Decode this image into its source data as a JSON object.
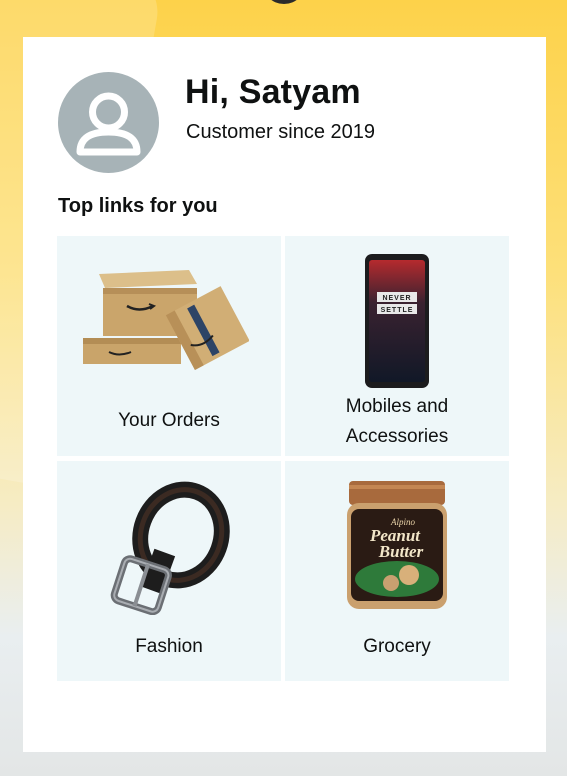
{
  "profile": {
    "greeting": "Hi, Satyam",
    "customer_since": "Customer since 2019",
    "avatar_icon": "user-silhouette-icon"
  },
  "top_links": {
    "title": "Top links for you",
    "items": [
      {
        "label": "Your Orders",
        "image": "amazon-boxes-image"
      },
      {
        "label_line1": "Mobiles and",
        "label_line2": "Accessories",
        "image": "smartphone-image"
      },
      {
        "label": "Fashion",
        "image": "leather-belt-image"
      },
      {
        "label": "Grocery",
        "image": "peanut-butter-jar-image"
      }
    ]
  },
  "product_text": {
    "phone_screen_line1": "NEVER",
    "phone_screen_line2": "SETTLE",
    "jar_line1": "Peanut",
    "jar_line2": "Butter",
    "jar_brand": "Alpino"
  },
  "colors": {
    "background_top": "#fdd24a",
    "card": "#ffffff",
    "tile": "#eef7f9",
    "avatar": "#a7b3b7",
    "text": "#0f1111"
  }
}
